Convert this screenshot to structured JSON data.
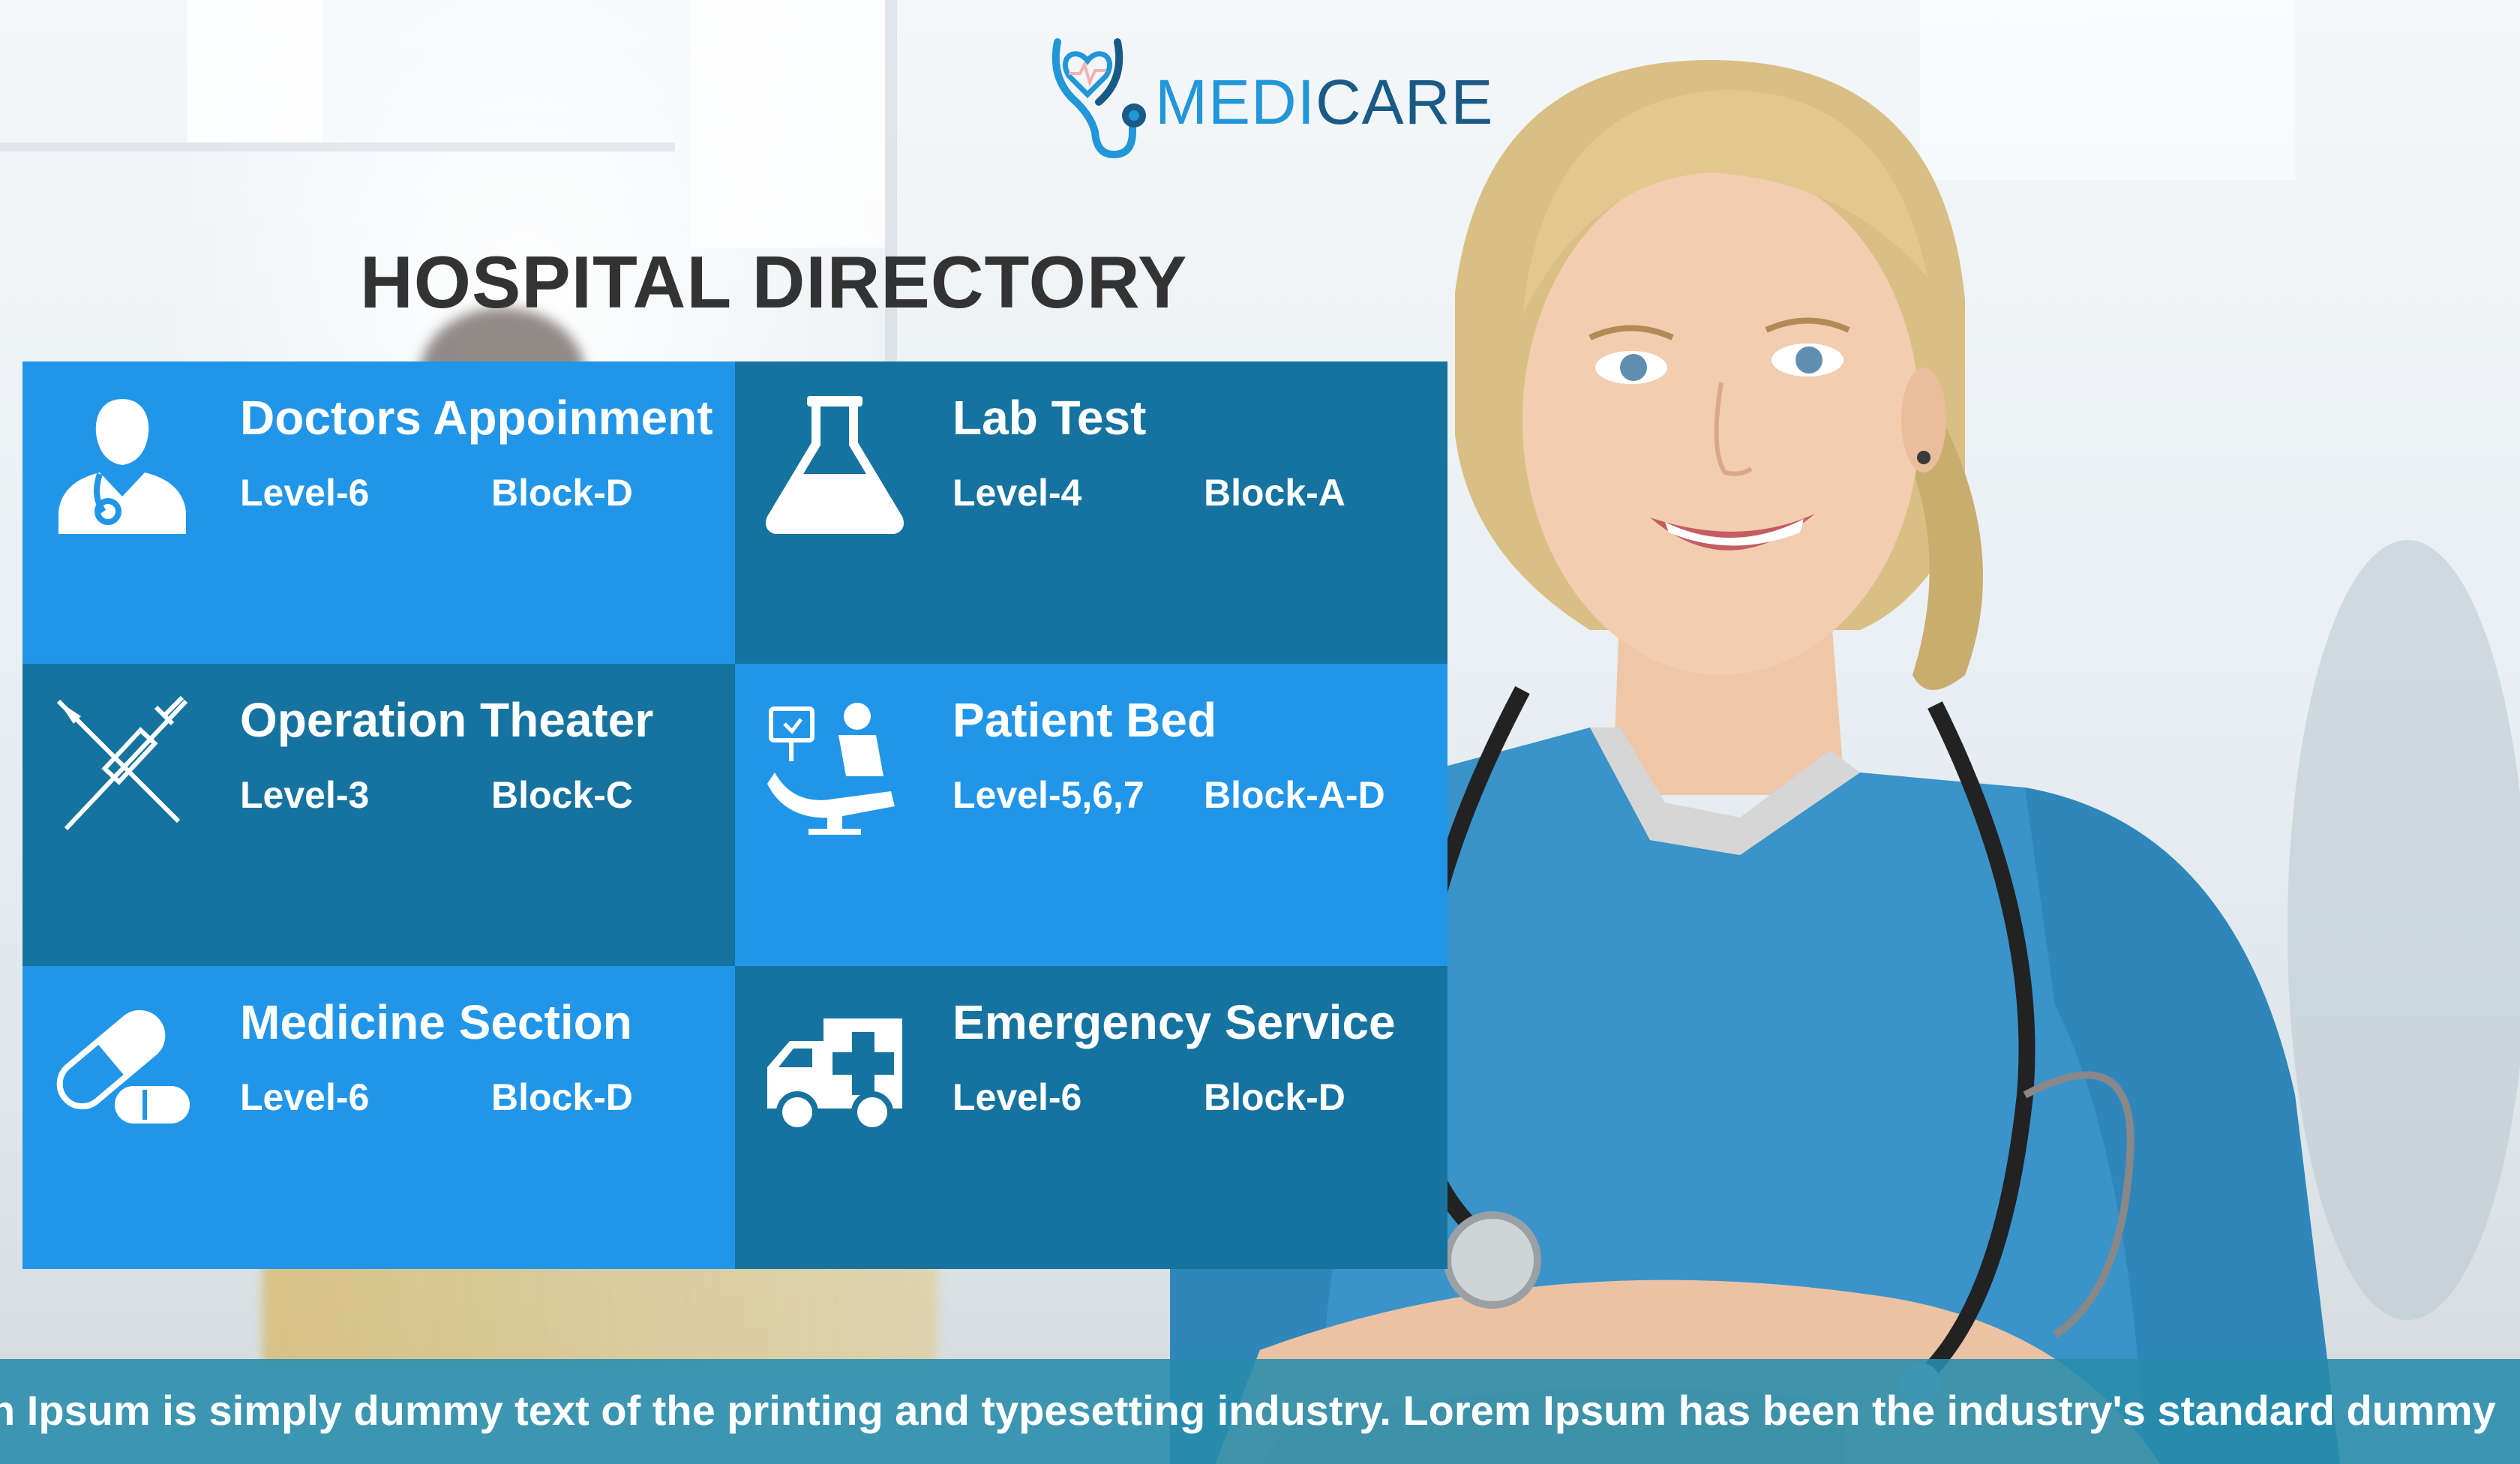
{
  "brand": {
    "name_part1": "MEDI",
    "name_part2": "CARE",
    "color_primary": "#2196d8",
    "color_secondary": "#1a5a86"
  },
  "page": {
    "title": "HOSPITAL DIRECTORY"
  },
  "directory": [
    {
      "name": "Doctors Appoinment",
      "level": "Level-6",
      "block": "Block-D",
      "icon": "doctor-icon",
      "shade": "light"
    },
    {
      "name": "Lab Test",
      "level": "Level-4",
      "block": "Block-A",
      "icon": "flask-icon",
      "shade": "dark"
    },
    {
      "name": "Operation Theater",
      "level": "Level-3",
      "block": "Block-C",
      "icon": "syringe-scalpel-icon",
      "shade": "dark"
    },
    {
      "name": "Patient Bed",
      "level": "Level-5,6,7",
      "block": "Block-A-D",
      "icon": "patient-bed-icon",
      "shade": "light"
    },
    {
      "name": "Medicine Section",
      "level": "Level-6",
      "block": "Block-D",
      "icon": "capsule-icon",
      "shade": "light"
    },
    {
      "name": "Emergency Service",
      "level": "Level-6",
      "block": "Block-D",
      "icon": "ambulance-icon",
      "shade": "dark"
    }
  ],
  "colors": {
    "tile_light": "#2196e8",
    "tile_dark": "#16739f",
    "ticker_bg": "#278cac"
  },
  "ticker": {
    "text": "n Ipsum is simply dummy text of the printing and typesetting industry. Lorem Ipsum has been the industry's standard dummy"
  }
}
